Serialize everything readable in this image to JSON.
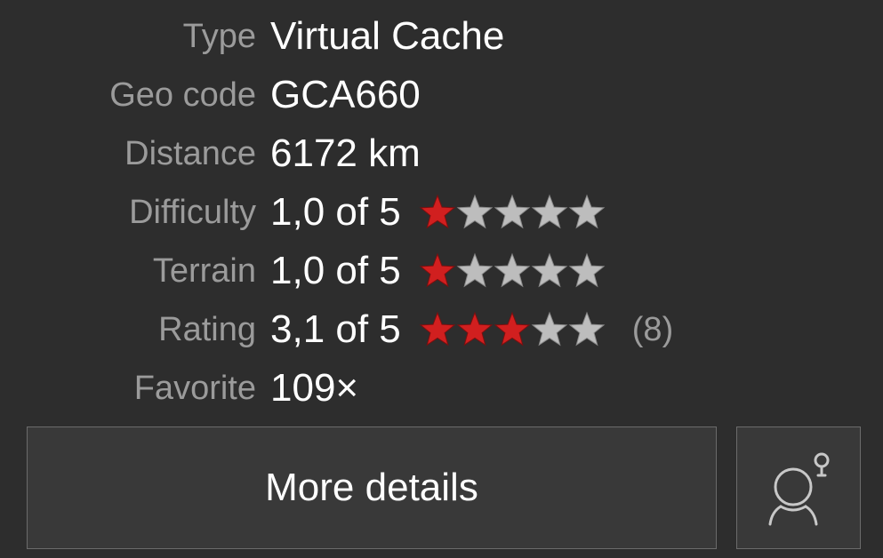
{
  "details": {
    "type": {
      "label": "Type",
      "value": "Virtual Cache"
    },
    "geo_code": {
      "label": "Geo code",
      "value": "GCA660"
    },
    "distance": {
      "label": "Distance",
      "value": "6172 km"
    },
    "difficulty": {
      "label": "Difficulty",
      "value": "1,0 of 5",
      "stars": 1.0
    },
    "terrain": {
      "label": "Terrain",
      "value": "1,0 of 5",
      "stars": 1.0
    },
    "rating": {
      "label": "Rating",
      "value": "3,1 of 5",
      "stars": 3,
      "count": "(8)"
    },
    "favorite": {
      "label": "Favorite",
      "value": "109×"
    }
  },
  "buttons": {
    "more_details": "More details",
    "hint_icon": "person-hint-icon"
  },
  "colors": {
    "background": "#2d2d2d",
    "label": "#9b9b9b",
    "value": "#ffffff",
    "star_filled": "#d11f1f",
    "star_empty": "#bdbdbd",
    "button_bg": "#393939",
    "button_border": "#6b6b6b"
  }
}
